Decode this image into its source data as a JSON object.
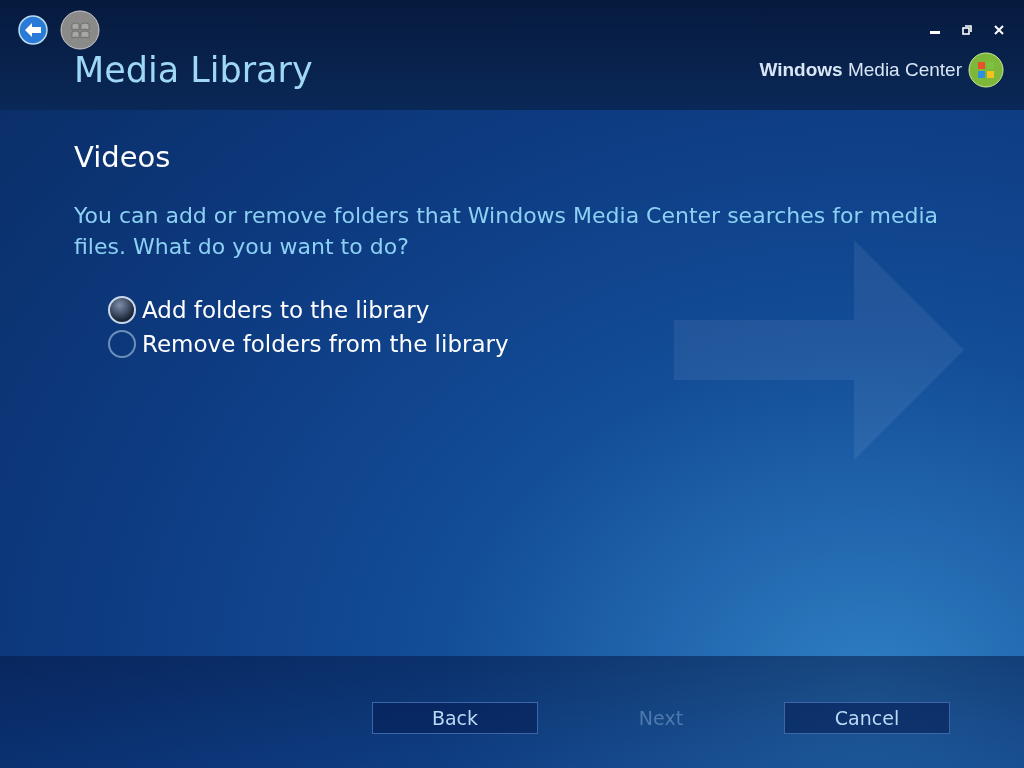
{
  "header": {
    "title": "Media Library",
    "brand": "**Windows** Media Center"
  },
  "page": {
    "heading": "Videos",
    "prompt": "You can add or remove folders that Windows Media Center searches for media files. What do you want to do?"
  },
  "options": [
    {
      "label": "Add folders to the library",
      "selected": true
    },
    {
      "label": "Remove folders from the library",
      "selected": false
    }
  ],
  "buttons": [
    {
      "label": "Back",
      "disabled": false
    },
    {
      "label": "Next",
      "disabled": true
    },
    {
      "label": "Cancel",
      "disabled": false
    }
  ]
}
